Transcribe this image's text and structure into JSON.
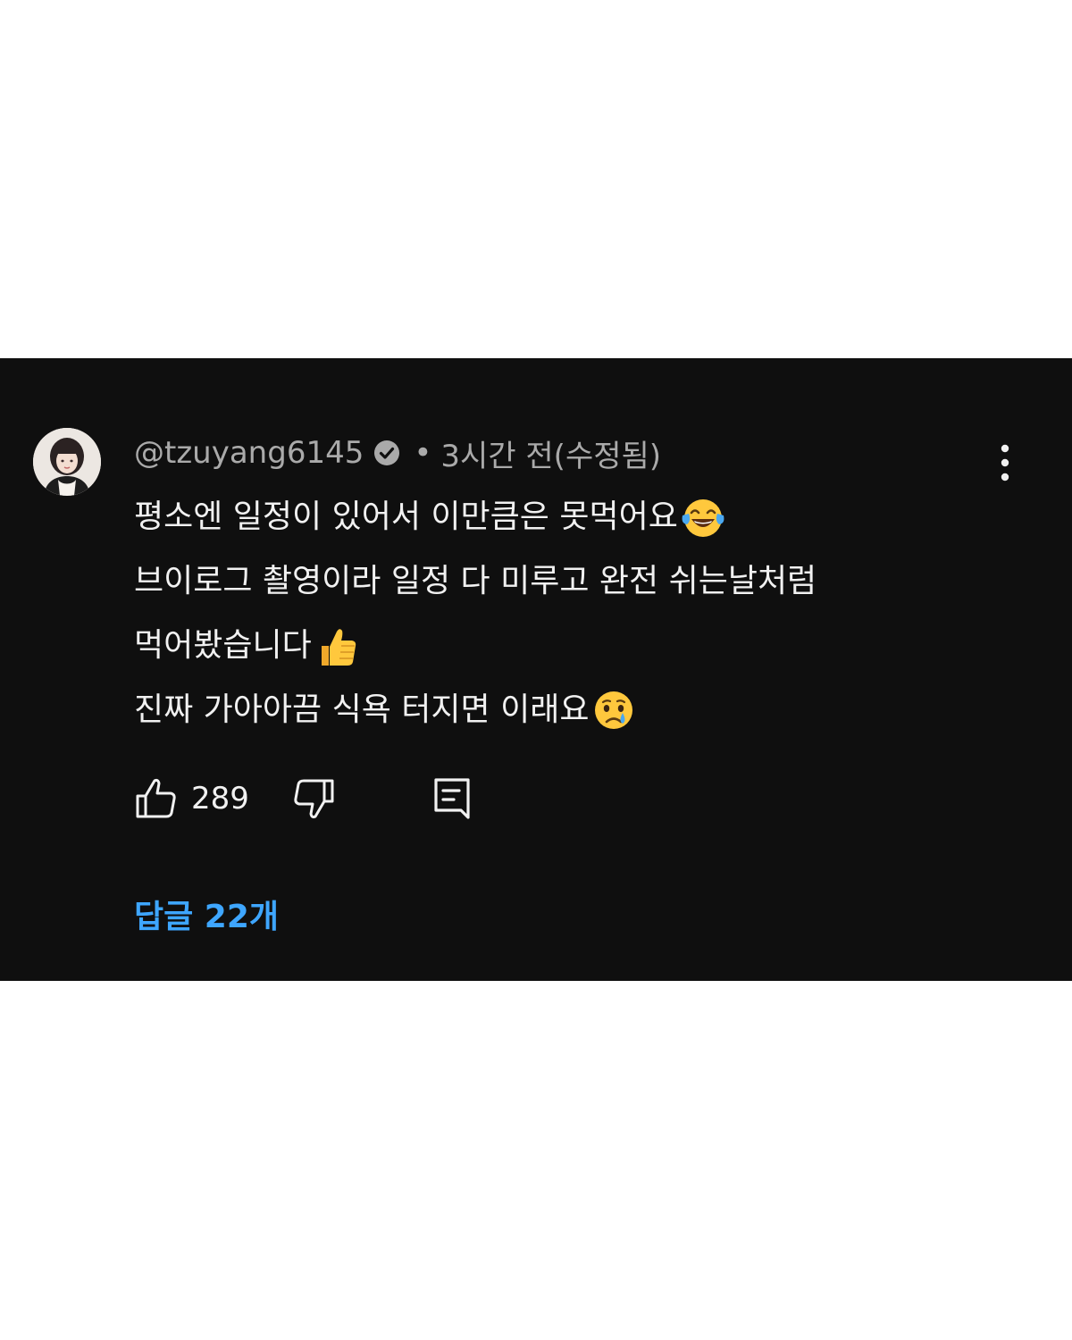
{
  "comment": {
    "avatar_icon": "user-avatar",
    "author": "@tzuyang6145",
    "verified_icon": "verified-checkmark-icon",
    "separator": "•",
    "time": "3시간 전(수정됨)",
    "more_icon": "more-vertical-icon",
    "lines": [
      {
        "text": "평소엔 일정이 있어서 이만큼은 못먹어요",
        "emoji": "face-with-tears-of-joy"
      },
      {
        "text": "브이로그 촬영이라 일정 다 미루고 완전 쉬는날처럼",
        "emoji": ""
      },
      {
        "text": "먹어봤습니다",
        "emoji": "thumbs-up"
      },
      {
        "text": "진짜 가아아끔 식욕 터지면 이래요",
        "emoji": "crying-face"
      }
    ],
    "like_count": "289",
    "like_icon": "thumbs-up-outline-icon",
    "dislike_icon": "thumbs-down-outline-icon",
    "reply_icon": "reply-icon",
    "replies_label": "답글 22개"
  },
  "colors": {
    "panel_background": "#0f0f0f",
    "page_background": "#ffffff",
    "text_primary": "#f1f1f1",
    "text_secondary": "#aaaaaa",
    "link_blue": "#3ea6ff"
  }
}
